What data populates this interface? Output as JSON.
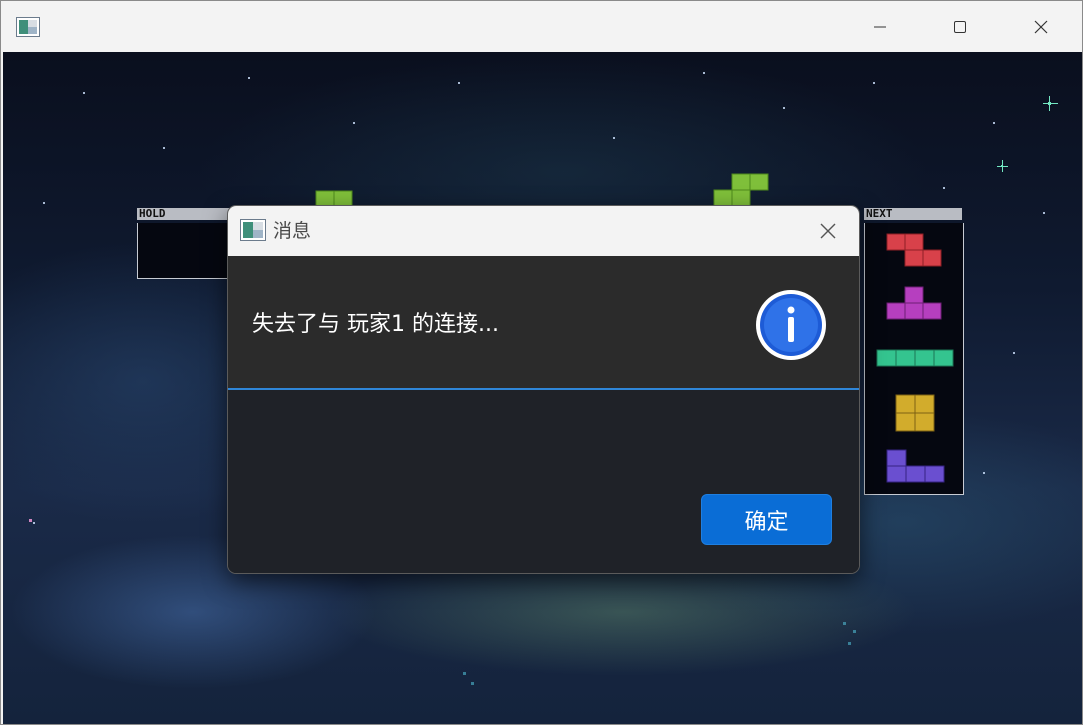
{
  "window": {
    "controls": {
      "minimize_icon": "minimize-icon",
      "maximize_icon": "maximize-icon",
      "close_icon": "close-icon"
    }
  },
  "game": {
    "hold_label": "HOLD",
    "next_label": "NEXT",
    "next_pieces": [
      "Z",
      "T",
      "I",
      "O",
      "J"
    ],
    "piece_colors": {
      "Z": "#d8414a",
      "T": "#b63fbf",
      "I": "#34c48f",
      "O": "#d2ac2c",
      "J": "#6a4fd0",
      "falling": "#7fbf3a"
    }
  },
  "dialog": {
    "title": "消息",
    "message": "失去了与 玩家1 的连接...",
    "ok_label": "确定",
    "icon": "info-icon",
    "accent": "#0a6dd6"
  }
}
